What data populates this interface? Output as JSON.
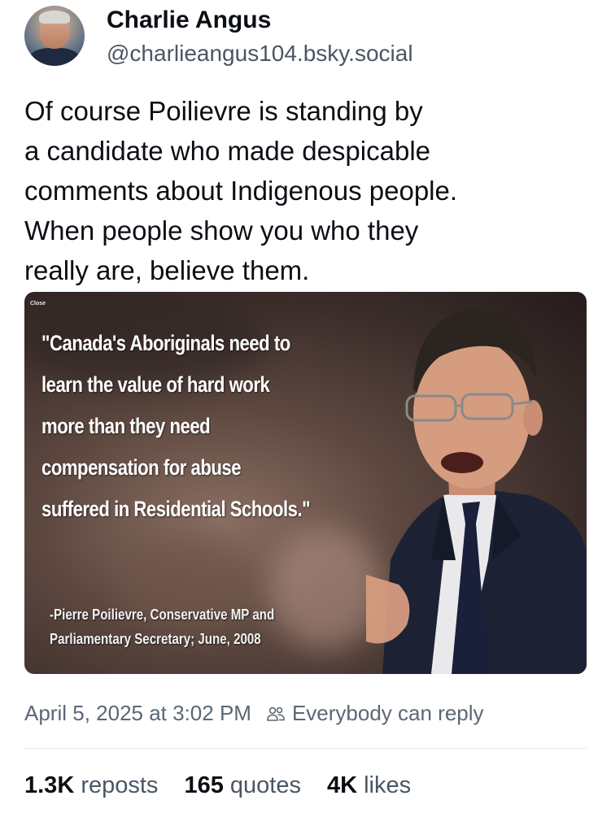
{
  "author": {
    "display_name": "Charlie Angus",
    "handle": "@charlieangus104.bsky.social"
  },
  "post": {
    "text_lines": [
      "Of course Poilievre is standing by",
      "a candidate who made despicable",
      "comments about Indigenous people.",
      "When people show you who they",
      "really are, believe them."
    ]
  },
  "embed": {
    "close_label": "Close",
    "quote_lines": [
      "\"Canada's Aboriginals need to",
      "learn the value of hard work",
      "more than they need",
      "compensation for abuse",
      "suffered in Residential Schools.\""
    ],
    "attribution_lines": [
      "-Pierre Poilievre, Conservative MP and",
      "Parliamentary Secretary; June, 2008"
    ]
  },
  "meta": {
    "timestamp": "April 5, 2025 at 3:02 PM",
    "reply_setting": "Everybody can reply",
    "reply_icon": "people-icon"
  },
  "stats": {
    "reposts_count": "1.3K",
    "reposts_label": "reposts",
    "quotes_count": "165",
    "quotes_label": "quotes",
    "likes_count": "4K",
    "likes_label": "likes"
  }
}
